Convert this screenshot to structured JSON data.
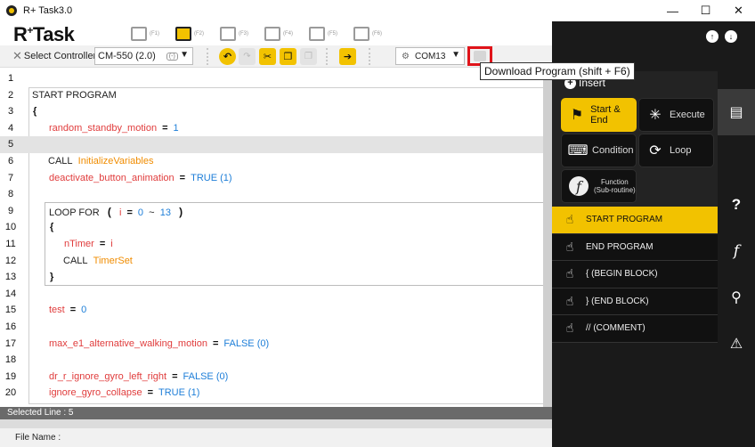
{
  "window": {
    "title": "R+ Task3.0",
    "minimize": "—",
    "maximize": "☐",
    "close": "✕"
  },
  "toolbar": {
    "logo_text": "R",
    "logo_sup": "+",
    "logo_rest": "Task",
    "nav": [
      {
        "icon": "home-icon",
        "shortcut": "(F1)"
      },
      {
        "icon": "monitor-icon",
        "shortcut": "(F2)"
      },
      {
        "icon": "debug-monitor-icon",
        "shortcut": "(F3)"
      },
      {
        "icon": "film-icon",
        "shortcut": "(F4)"
      },
      {
        "icon": "clapper-icon",
        "shortcut": "(F5)"
      },
      {
        "icon": "download-icon",
        "shortcut": "(F6)"
      }
    ],
    "select_controller_label": "Select Controller",
    "controller_value": "CM-550 (2.0)",
    "controller_version": "(-)",
    "port_value": "COM13",
    "download_tooltip": "Download Program (shift + F6)"
  },
  "editor": {
    "lines": [
      {
        "n": "1"
      },
      {
        "n": "2",
        "text": "START PROGRAM"
      },
      {
        "n": "3",
        "text": "{"
      },
      {
        "n": "4",
        "var": "random_standby_motion",
        "op": "=",
        "val": "1"
      },
      {
        "n": "5"
      },
      {
        "n": "6",
        "kw": "CALL",
        "fn": "InitializeVariables"
      },
      {
        "n": "7",
        "var": "deactivate_button_animation",
        "op": "=",
        "val": "TRUE (1)"
      },
      {
        "n": "8"
      },
      {
        "n": "9",
        "kw": "LOOP FOR",
        "paren_open": "(",
        "var": "i",
        "op": "=",
        "val": "0",
        "tilde": "~",
        "val2": "13",
        "paren_close": ")"
      },
      {
        "n": "10",
        "text": "{"
      },
      {
        "n": "11",
        "var": "nTimer",
        "op": "=",
        "val": "i"
      },
      {
        "n": "12",
        "kw": "CALL",
        "fn": "TimerSet"
      },
      {
        "n": "13",
        "text": "}"
      },
      {
        "n": "14"
      },
      {
        "n": "15",
        "var": "test",
        "op": "=",
        "val": "0"
      },
      {
        "n": "16"
      },
      {
        "n": "17",
        "var": "max_e1_alternative_walking_motion",
        "op": "=",
        "val": "FALSE (0)"
      },
      {
        "n": "18"
      },
      {
        "n": "19",
        "var": "dr_r_ignore_gyro_left_right",
        "op": "=",
        "val": "FALSE (0)"
      },
      {
        "n": "20",
        "var": "ignore_gyro_collapse",
        "op": "=",
        "val": "TRUE (1)"
      }
    ]
  },
  "status": {
    "selected_line": "Selected Line : 5",
    "file_name": "File Name :"
  },
  "panel": {
    "insert_label": "Insert",
    "categories": [
      {
        "label": "Start & End",
        "icon": "flag-icon"
      },
      {
        "label": "Execute",
        "icon": "spinner-icon"
      },
      {
        "label": "Condition",
        "icon": "code-icon"
      },
      {
        "label": "Loop",
        "icon": "loop-icon"
      },
      {
        "label1": "Function",
        "label2": "(Sub-routine)",
        "icon": "function-icon"
      }
    ],
    "commands": [
      {
        "label": "START PROGRAM"
      },
      {
        "label": "END PROGRAM"
      },
      {
        "label": "{   (BEGIN BLOCK)"
      },
      {
        "label": "}   (END BLOCK)"
      },
      {
        "label": "//   (COMMENT)"
      }
    ]
  },
  "colors": {
    "accent": "#f2c200",
    "variable": "#e03c3c",
    "function": "#f08c00",
    "number": "#1d7ed8",
    "highlight": "#e0141a"
  }
}
